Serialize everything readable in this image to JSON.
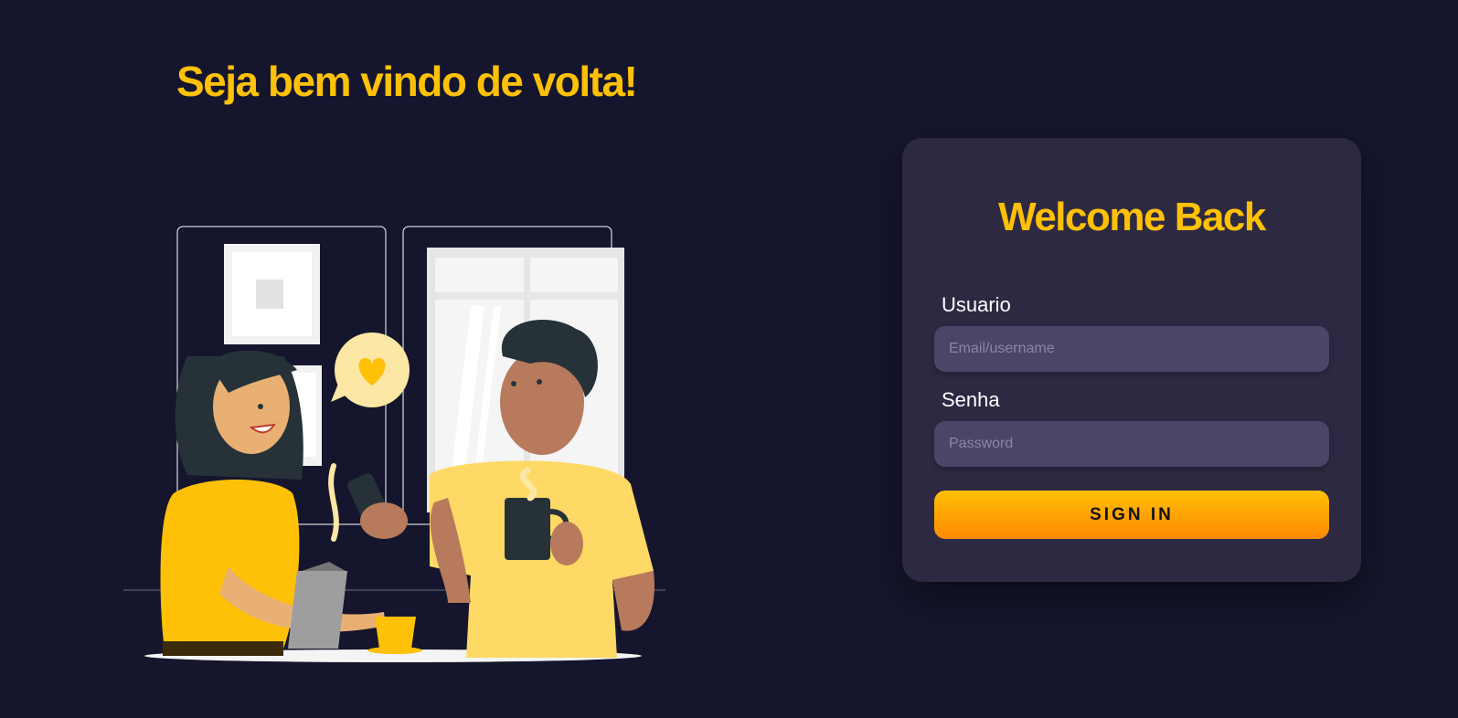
{
  "hero": {
    "headline": "Seja bem vindo de volta!",
    "illustration_icon": "two-people-chatting-over-coffee-illustration"
  },
  "login_card": {
    "title": "Welcome Back",
    "username": {
      "label": "Usuario",
      "placeholder": "Email/username",
      "value": ""
    },
    "password": {
      "label": "Senha",
      "placeholder": "Password",
      "value": ""
    },
    "submit_label": "SIGN IN"
  },
  "colors": {
    "background": "#15162d",
    "accent": "#ffc107",
    "card": "#2e2943",
    "input": "#4d4568",
    "button_gradient_end": "#ff8a00"
  }
}
